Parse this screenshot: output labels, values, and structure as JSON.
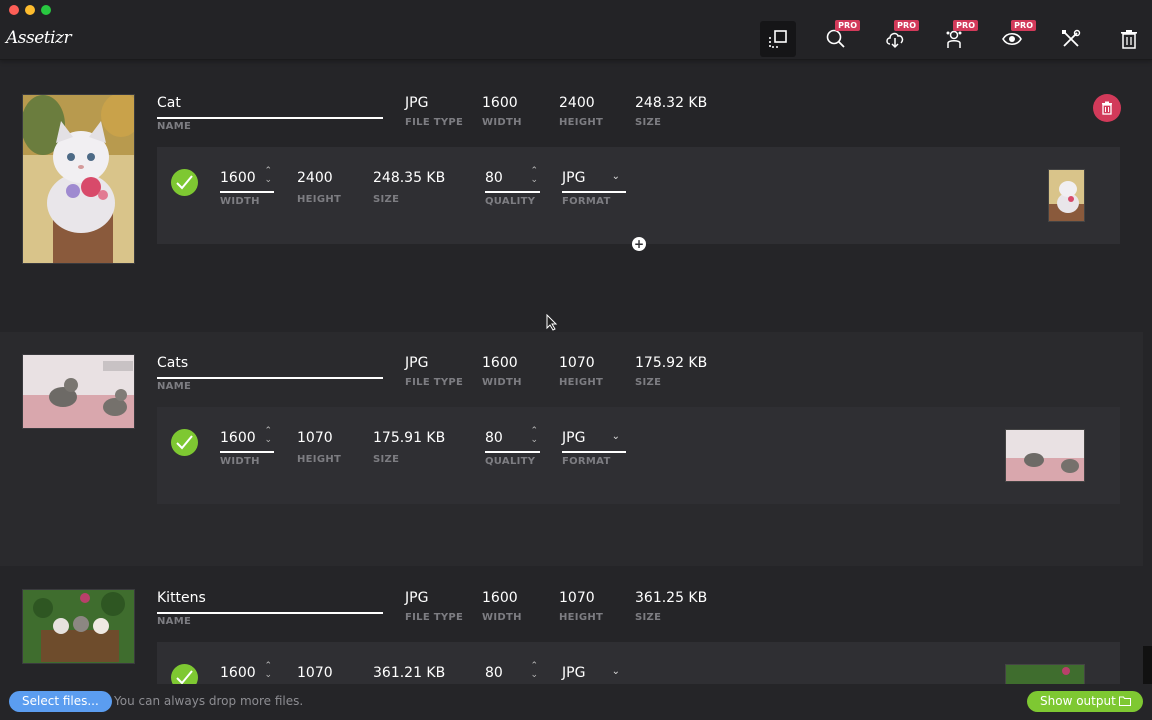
{
  "app": {
    "logo_text": "Assetizr"
  },
  "toolbar": {
    "pro_label": "PRO",
    "buttons": [
      {
        "icon": "resize-icon",
        "active": true,
        "pro": false
      },
      {
        "icon": "search-icon",
        "active": false,
        "pro": true
      },
      {
        "icon": "cloud-download-icon",
        "active": false,
        "pro": true
      },
      {
        "icon": "user-settings-icon",
        "active": false,
        "pro": true
      },
      {
        "icon": "eye-icon",
        "active": false,
        "pro": true
      },
      {
        "icon": "tools-icon",
        "active": false,
        "pro": false
      },
      {
        "icon": "trash-icon",
        "active": false,
        "pro": false
      }
    ]
  },
  "labels": {
    "name": "NAME",
    "file_type": "FILE TYPE",
    "width": "WIDTH",
    "height": "HEIGHT",
    "size": "SIZE",
    "quality": "QUALITY",
    "format": "FORMAT"
  },
  "items": [
    {
      "name": "Cat",
      "file_type": "JPG",
      "width": "1600",
      "height": "2400",
      "size": "248.32 KB",
      "output": {
        "width": "1600",
        "height": "2400",
        "size": "248.35 KB",
        "quality": "80",
        "format": "JPG"
      }
    },
    {
      "name": "Cats",
      "file_type": "JPG",
      "width": "1600",
      "height": "1070",
      "size": "175.92 KB",
      "output": {
        "width": "1600",
        "height": "1070",
        "size": "175.91 KB",
        "quality": "80",
        "format": "JPG"
      }
    },
    {
      "name": "Kittens",
      "file_type": "JPG",
      "width": "1600",
      "height": "1070",
      "size": "361.25 KB",
      "output": {
        "width": "1600",
        "height": "1070",
        "size": "361.21 KB",
        "quality": "80",
        "format": "JPG"
      }
    }
  ],
  "bottom": {
    "select_button": "Select files...",
    "hint": "You can always drop more files.",
    "show_output": "Show output"
  },
  "colors": {
    "accent_green": "#7ec832",
    "accent_blue": "#5b9df0",
    "pro_red": "#d23a5a",
    "background": "#252528"
  }
}
